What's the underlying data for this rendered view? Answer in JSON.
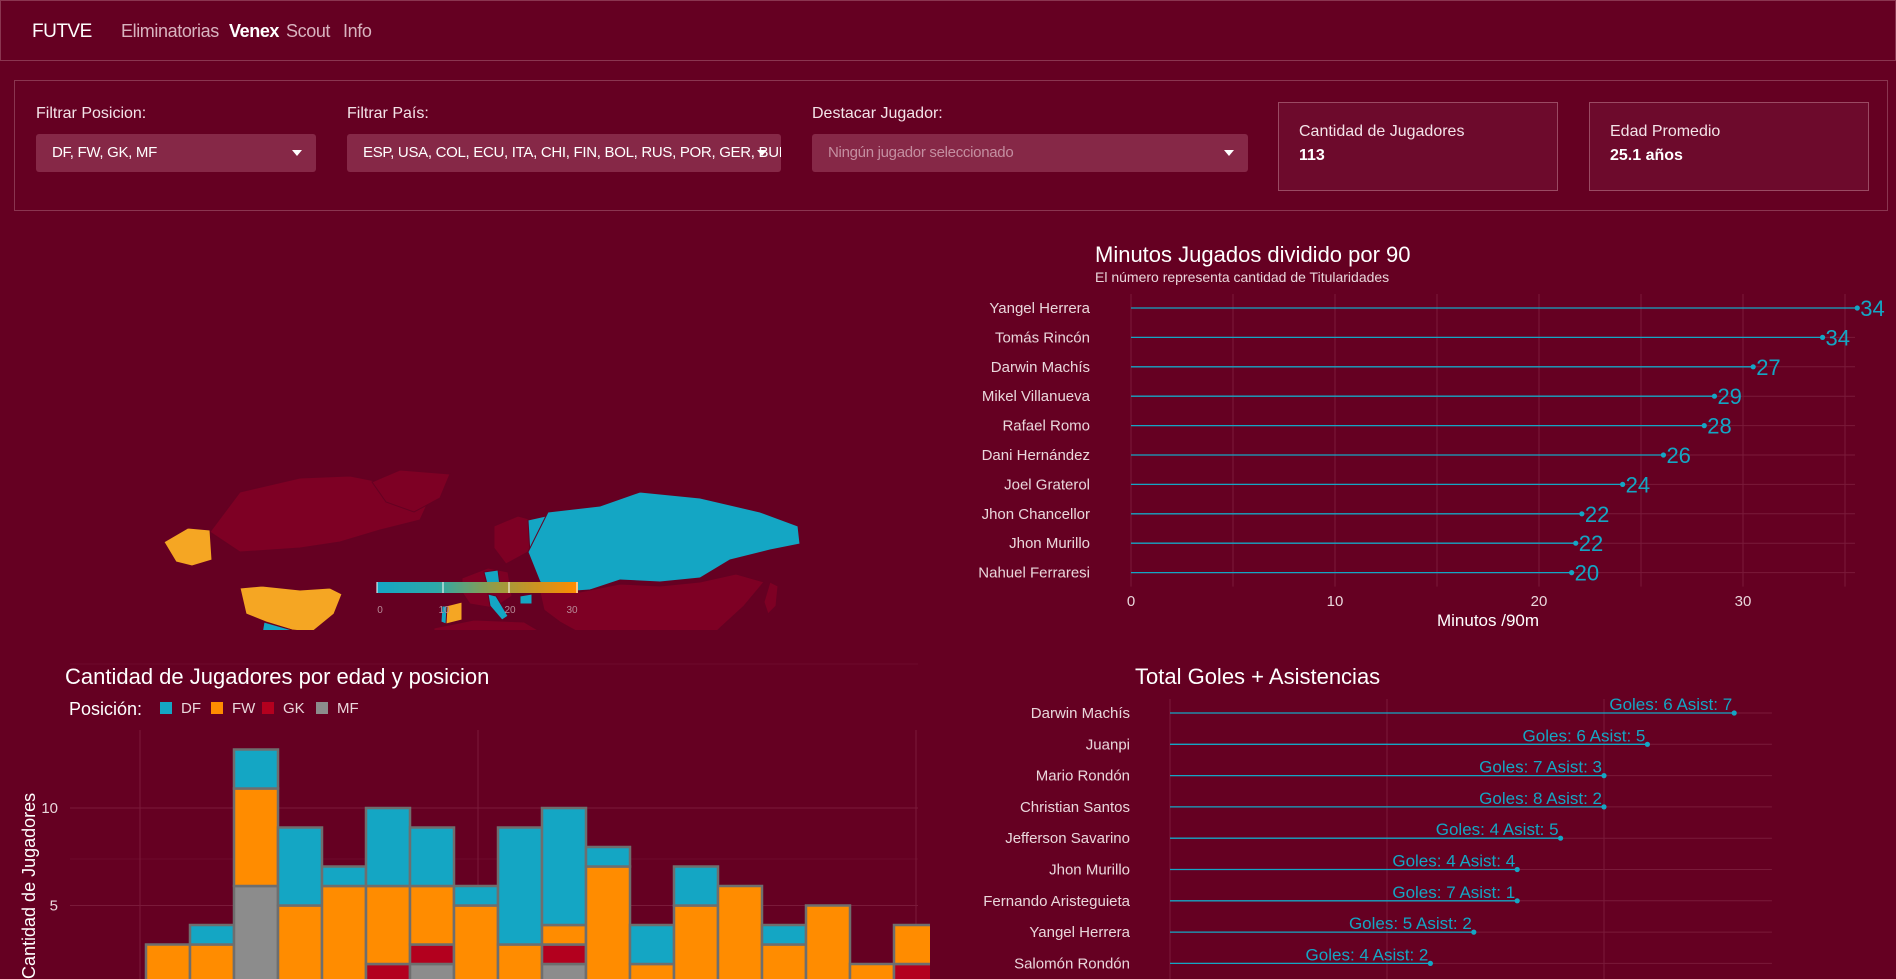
{
  "navbar": {
    "brand": "FUTVE",
    "links": [
      "Eliminatorias",
      "Venex",
      "Scout",
      "Info"
    ],
    "active": "Venex"
  },
  "filters": {
    "posicion": {
      "label": "Filtrar Posicion:",
      "value": "DF, FW, GK, MF"
    },
    "pais": {
      "label": "Filtrar País:",
      "value": "ESP, USA, COL, ECU, ITA, CHI, FIN, BOL, RUS, POR, GER, BUL, "
    },
    "jugador": {
      "label": "Destacar Jugador:",
      "placeholder": "Ningún jugador seleccionado"
    }
  },
  "stats": {
    "jugadores": {
      "label": "Cantidad de Jugadores",
      "value": "113"
    },
    "edad": {
      "label": "Edad Promedio",
      "value": "25.1 años"
    }
  },
  "colors": {
    "background": "#650022",
    "teal": "#14a6c4",
    "orange": "#ff8c00",
    "land": "#7e0024",
    "gk": "#b3001e",
    "mf": "#8c8c8c"
  },
  "map": {
    "legend_ticks": [
      "0",
      "10",
      "20",
      "30"
    ],
    "highlighted_teal": [
      "Russia",
      "Finland",
      "Ecuador",
      "Colombia",
      "Chile",
      "Bolivia",
      "Bulgaria",
      "Italy",
      "Germany",
      "Portugal",
      "Argentina",
      "Mexico",
      "Japan"
    ],
    "highlighted_orange": [
      "USA",
      "Venezuela",
      "Spain"
    ]
  },
  "chart_data": [
    {
      "type": "lollipop",
      "title": "Minutos Jugados dividido por 90",
      "subtitle": "El número representa cantidad de Titularidades",
      "xlabel": "Minutos /90m",
      "xlim": [
        0,
        35
      ],
      "xticks": [
        "0",
        "10",
        "20",
        "30"
      ],
      "categories": [
        "Yangel Herrera",
        "Tomás Rincón",
        "Darwin Machís",
        "Mikel Villanueva",
        "Rafael Romo",
        "Dani Hernández",
        "Joel Graterol",
        "Jhon Chancellor",
        "Jhon Murillo",
        "Nahuel Ferraresi"
      ],
      "values": [
        35.6,
        33.9,
        30.5,
        28.6,
        28.1,
        26.1,
        24.1,
        22.1,
        21.8,
        21.6
      ],
      "labels": [
        "34",
        "34",
        "27",
        "29",
        "28",
        "26",
        "24",
        "22",
        "22",
        "20"
      ]
    },
    {
      "type": "lollipop",
      "title": "Total Goles + Asistencias",
      "xlim": [
        0,
        13.5
      ],
      "categories": [
        "Darwin Machís",
        "Juanpi",
        "Mario Rondón",
        "Christian Santos",
        "Jefferson Savarino",
        "Jhon Murillo",
        "Fernando Aristeguieta",
        "Yangel Herrera",
        "Salomón Rondón"
      ],
      "values": [
        13,
        11,
        10,
        10,
        9,
        8,
        8,
        7,
        6
      ],
      "labels": [
        "Goles: 6  Asist: 7",
        "Goles: 6  Asist: 5",
        "Goles: 7  Asist: 3",
        "Goles: 8  Asist: 2",
        "Goles: 4  Asist: 5",
        "Goles: 4  Asist: 4",
        "Goles: 7  Asist: 1",
        "Goles: 5  Asist: 2",
        "Goles: 4  Asist: 2"
      ]
    },
    {
      "type": "bar",
      "stacked": true,
      "title": "Cantidad de Jugadores por edad y posicion",
      "ylabel": "Cantidad de Jugadores",
      "legend_title": "Posición:",
      "legend": [
        "DF",
        "FW",
        "GK",
        "MF"
      ],
      "yticks": [
        "5",
        "10"
      ],
      "series": [
        {
          "name": "MF",
          "values": [
            0,
            1,
            6,
            1,
            1,
            1,
            2,
            1,
            1,
            2,
            1,
            1,
            1,
            1,
            1,
            1,
            0,
            1
          ]
        },
        {
          "name": "GK",
          "values": [
            0,
            0,
            0,
            0,
            0,
            1,
            1,
            0,
            0,
            1,
            0,
            0,
            0,
            0,
            0,
            0,
            0,
            1
          ]
        },
        {
          "name": "FW",
          "values": [
            3,
            2,
            5,
            4,
            5,
            4,
            3,
            4,
            2,
            1,
            6,
            1,
            4,
            5,
            2,
            4,
            2,
            2
          ]
        },
        {
          "name": "DF",
          "values": [
            0,
            1,
            2,
            4,
            1,
            4,
            3,
            1,
            6,
            6,
            1,
            2,
            2,
            0,
            1,
            0,
            0,
            0
          ]
        }
      ]
    }
  ]
}
